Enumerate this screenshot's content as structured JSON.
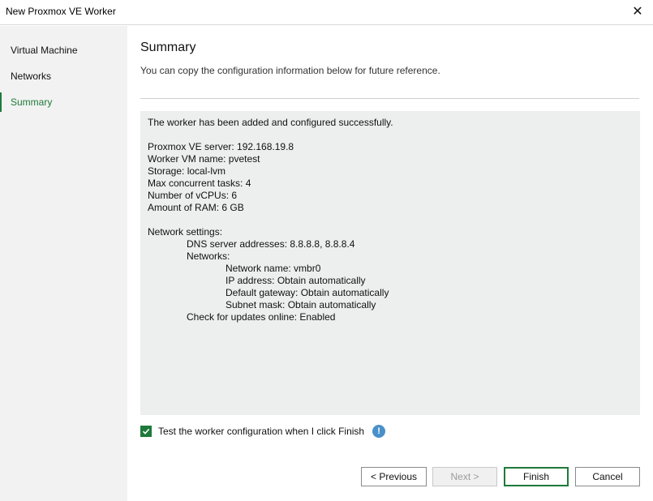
{
  "window": {
    "title": "New Proxmox VE Worker"
  },
  "sidebar": {
    "items": [
      {
        "label": "Virtual Machine"
      },
      {
        "label": "Networks"
      },
      {
        "label": "Summary"
      }
    ]
  },
  "main": {
    "title": "Summary",
    "subtitle": "You can copy the configuration information below for future reference.",
    "summary_lines": [
      "The worker has been added and configured successfully.",
      "",
      "Proxmox VE server: 192.168.19.8",
      "Worker VM name: pvetest",
      "Storage: local-lvm",
      "Max concurrent tasks: 4",
      "Number of vCPUs: 6",
      "Amount of RAM: 6 GB",
      "",
      "Network settings:",
      "DNS server addresses: 8.8.8.8, 8.8.8.4",
      "Networks:",
      "Network name: vmbr0",
      "IP address: Obtain automatically",
      "Default gateway: Obtain automatically",
      "Subnet mask: Obtain automatically",
      "Check for updates online: Enabled"
    ],
    "test_checkbox": {
      "label": "Test the worker configuration when I click Finish",
      "checked": true
    }
  },
  "buttons": {
    "previous": "< Previous",
    "next": "Next >",
    "finish": "Finish",
    "cancel": "Cancel"
  },
  "colors": {
    "accent": "#1e7a3a",
    "info": "#4a90c9"
  },
  "icons": {
    "close": "close-icon",
    "check": "checkmark-icon",
    "info": "info-icon"
  }
}
